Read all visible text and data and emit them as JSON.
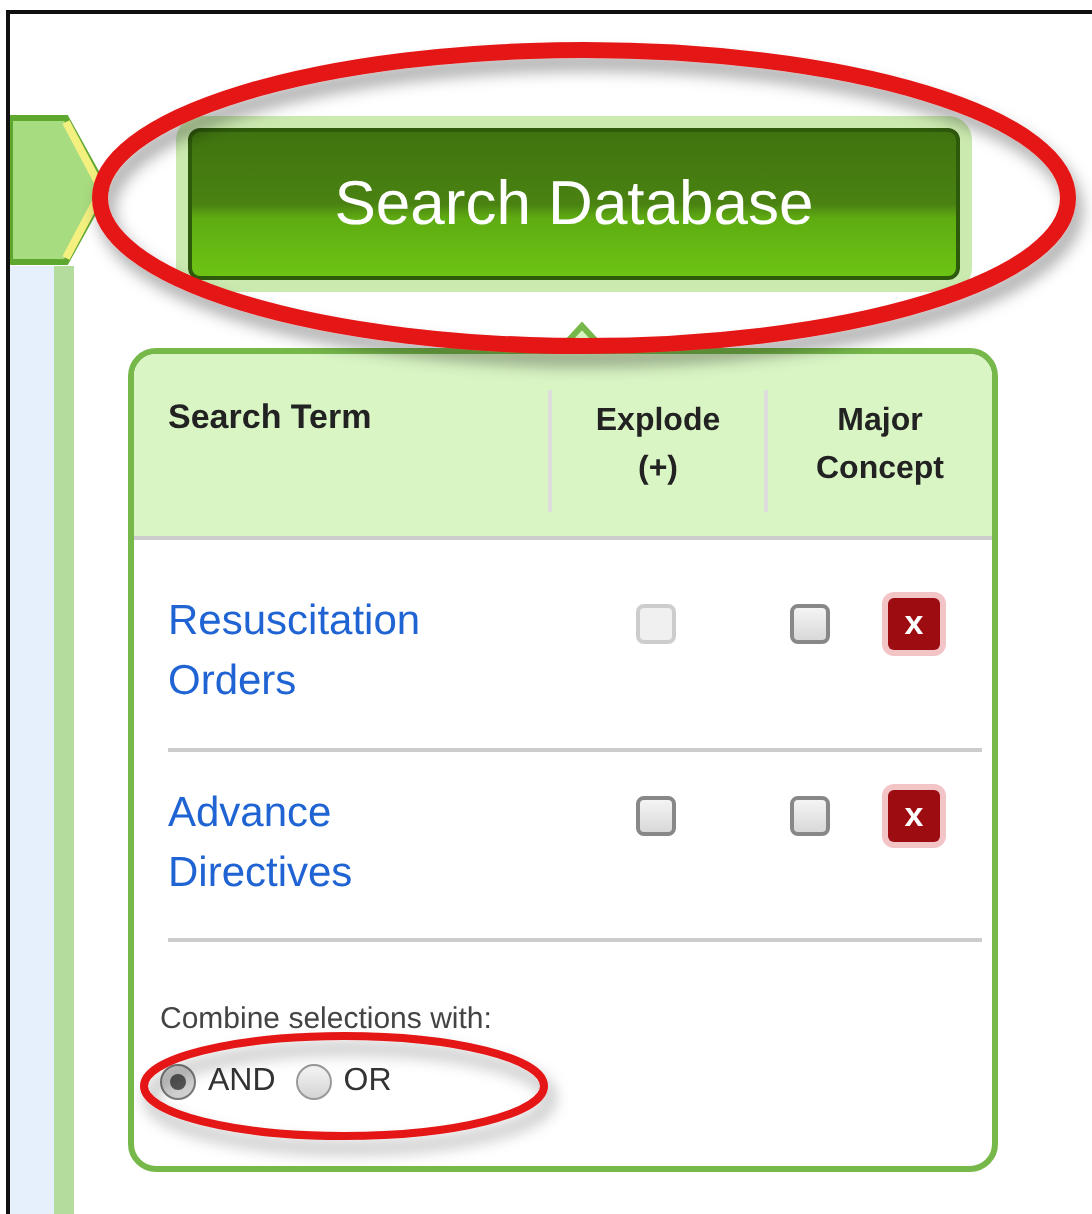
{
  "search_button": {
    "label": "Search Database"
  },
  "table": {
    "columns": [
      "Search Term",
      "Explode (+)",
      "Major Concept"
    ],
    "rows": [
      {
        "term": "Resuscitation Orders",
        "explode": {
          "checked": false,
          "disabled": true
        },
        "major": {
          "checked": false,
          "disabled": false
        },
        "remove": "x"
      },
      {
        "term": "Advance Directives",
        "explode": {
          "checked": false,
          "disabled": false
        },
        "major": {
          "checked": false,
          "disabled": false
        },
        "remove": "x"
      }
    ]
  },
  "combine": {
    "label": "Combine selections with:",
    "options": [
      {
        "label": "AND",
        "selected": true
      },
      {
        "label": "OR",
        "selected": false
      }
    ]
  }
}
